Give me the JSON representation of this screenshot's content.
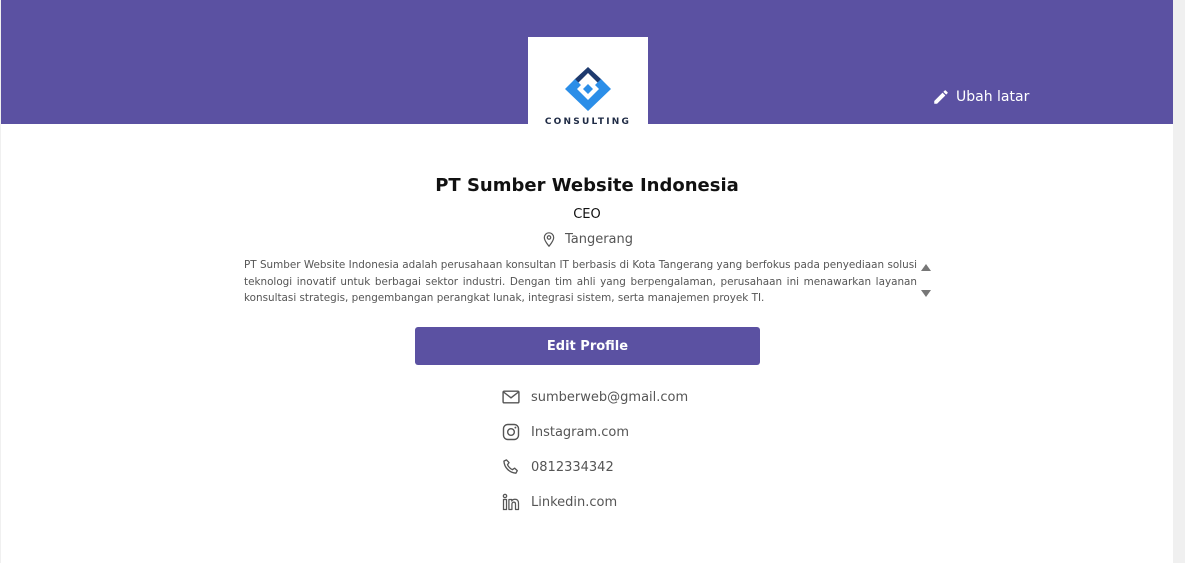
{
  "banner": {
    "color": "#5b51a2",
    "edit_background_label": "Ubah latar",
    "edit_icon": "pencil-icon"
  },
  "logo": {
    "text": "CONSULTING",
    "colors": [
      "#1e3a6e",
      "#2b8ee8"
    ]
  },
  "profile": {
    "name": "PT Sumber Website Indonesia",
    "role": "CEO",
    "location": "Tangerang",
    "location_icon": "location-pin-icon",
    "description": "PT Sumber Website Indonesia adalah perusahaan konsultan IT berbasis di Kota Tangerang yang berfokus pada penyediaan solusi teknologi inovatif untuk berbagai sektor industri. Dengan tim ahli yang berpengalaman, perusahaan ini menawarkan layanan konsultasi strategis, pengembangan perangkat lunak, integrasi sistem, serta manajemen proyek TI."
  },
  "actions": {
    "edit_profile_label": "Edit Profile",
    "button_color": "#5b51a2"
  },
  "contacts": [
    {
      "icon": "mail-icon",
      "value": "sumberweb@gmail.com"
    },
    {
      "icon": "instagram-icon",
      "value": "Instagram.com"
    },
    {
      "icon": "phone-icon",
      "value": "0812334342"
    },
    {
      "icon": "linkedin-icon",
      "value": "Linkedin.com"
    }
  ]
}
